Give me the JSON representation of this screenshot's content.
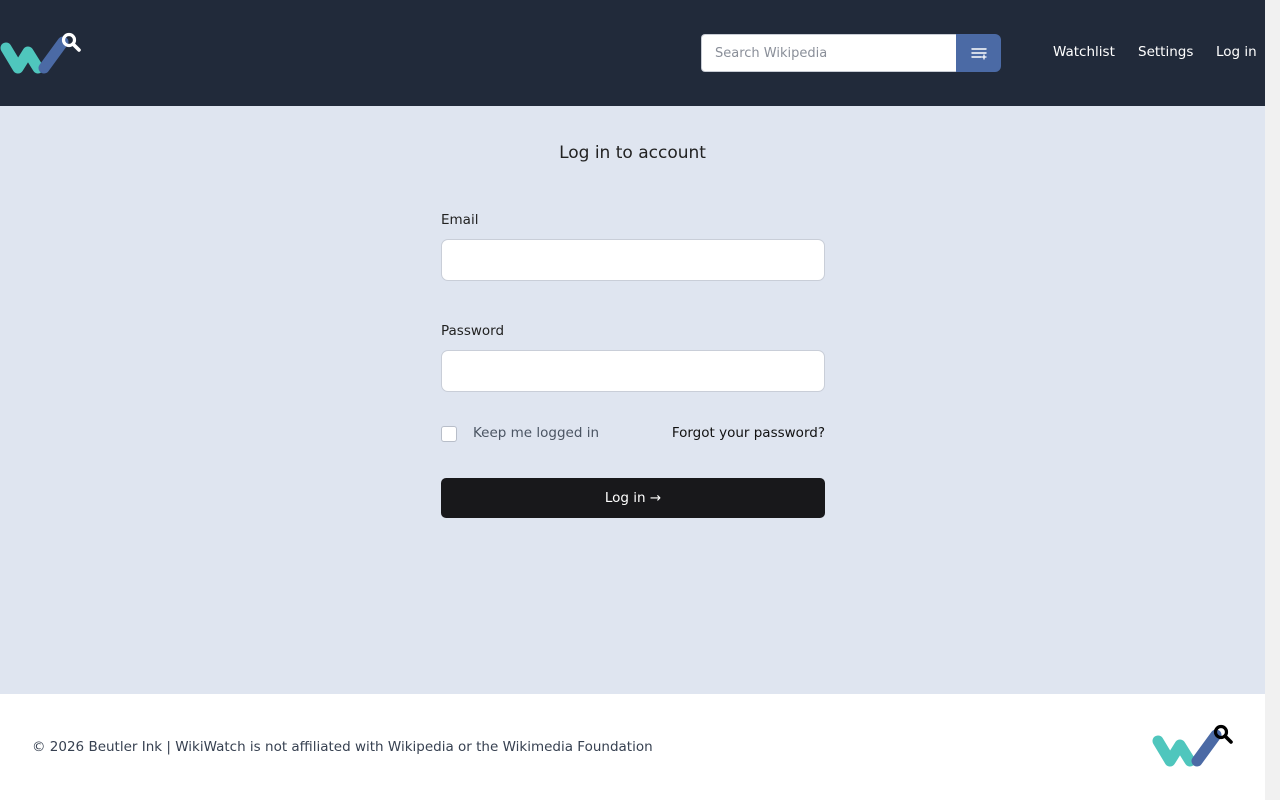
{
  "header": {
    "logo_icon": "wikiwatch-logo-icon",
    "search": {
      "placeholder": "Search Wikipedia",
      "button_icon": "list-filter-icon"
    },
    "nav": [
      {
        "label": "Watchlist"
      },
      {
        "label": "Settings"
      },
      {
        "label": "Log in"
      }
    ]
  },
  "login": {
    "title": "Log in to account",
    "email_label": "Email",
    "email_value": "",
    "password_label": "Password",
    "password_value": "",
    "remember_label": "Keep me logged in",
    "remember_checked": false,
    "forgot_label": "Forgot your password?",
    "submit_label": "Log in →"
  },
  "footer": {
    "text": "© 2026 Beutler Ink | WikiWatch is not affiliated with Wikipedia or the Wikimedia Foundation",
    "logo_icon": "wikiwatch-logo-icon"
  },
  "colors": {
    "header_bg": "#212a3a",
    "page_bg": "#dfe5f0",
    "accent": "#4b6aa5",
    "logo_teal": "#4fc6bd",
    "logo_blue": "#4b6aa5",
    "button_dark": "#18181b"
  }
}
